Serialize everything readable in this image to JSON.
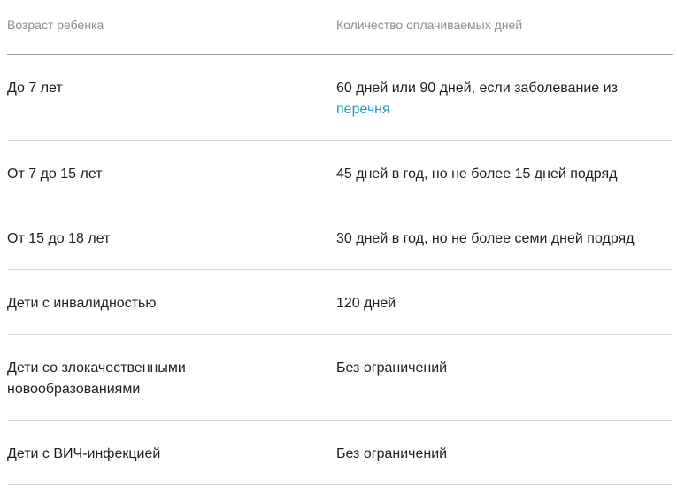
{
  "table": {
    "headers": {
      "age": "Возраст ребенка",
      "days": "Количество оплачиваемых дней"
    },
    "rows": [
      {
        "age": "До 7 лет",
        "days": "60 дней или 90 дней, если заболевание из",
        "link": "перечня"
      },
      {
        "age": "От 7 до 15 лет",
        "days": "45 дней в год, но не более 15 дней подряд"
      },
      {
        "age": "От 15 до 18 лет",
        "days": "30 дней в год, но не более семи дней подряд"
      },
      {
        "age": "Дети с инвалидностью",
        "days": "120 дней"
      },
      {
        "age": "Дети со злокачественными новообразованиями",
        "days": "Без ограничений"
      },
      {
        "age": "Дети с ВИЧ-инфекцией",
        "days": "Без ограничений"
      }
    ]
  }
}
